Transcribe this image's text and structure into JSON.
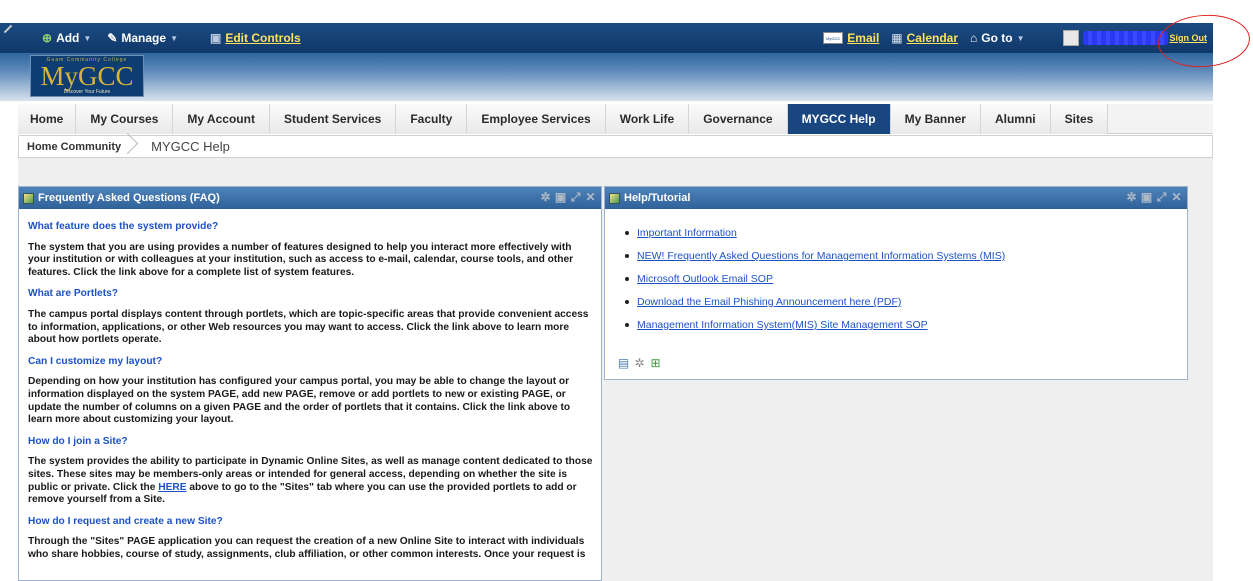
{
  "topbar": {
    "add_label": "Add",
    "manage_label": "Manage",
    "edit_controls_label": "Edit Controls",
    "email_label": "Email",
    "calendar_label": "Calendar",
    "goto_label": "Go to",
    "signout_label": "Sign Out"
  },
  "logo": {
    "top_text": "Guam Community College",
    "name": "MyGCC",
    "tagline": "Discover Your Future",
    "mini_logo_text": "MyGCC"
  },
  "nav": {
    "tabs": [
      {
        "label": "Home"
      },
      {
        "label": "My Courses"
      },
      {
        "label": "My Account"
      },
      {
        "label": "Student Services"
      },
      {
        "label": "Faculty"
      },
      {
        "label": "Employee Services"
      },
      {
        "label": "Work Life"
      },
      {
        "label": "Governance"
      },
      {
        "label": "MYGCC Help"
      },
      {
        "label": "My Banner"
      },
      {
        "label": "Alumni"
      },
      {
        "label": "Sites"
      }
    ],
    "active_tab": "MYGCC Help"
  },
  "breadcrumb": {
    "home": "Home Community",
    "current": "MYGCC Help"
  },
  "faq": {
    "title": "Frequently Asked Questions (FAQ)",
    "items": [
      {
        "q": "What feature does the system provide?",
        "a": "The system that you are using provides a number of features designed to help you interact more effectively with your institution or with colleagues at your institution, such as access to e-mail, calendar, course tools, and other features. Click the link above for a complete list of system features."
      },
      {
        "q": "What are Portlets?",
        "a": "The campus portal displays content through portlets, which are topic-specific areas that provide convenient access to information, applications, or other Web resources you may want to access. Click the link above to learn more about how portlets operate."
      },
      {
        "q": "Can I customize my layout?",
        "a": "Depending on how your institution has configured your campus portal, you may be able to change the layout or information displayed on the system PAGE, add new PAGE, remove or add portlets to new or existing PAGE, or update the number of columns on a given PAGE and the order of portlets that it contains. Click the link above to learn more about customizing your layout."
      },
      {
        "q": "How do I join a Site?",
        "a_before": "The system provides the ability to participate in Dynamic Online Sites, as well as manage content dedicated to those sites. These sites may be members-only areas or intended for general access, depending on whether the site is public or private. Click the ",
        "a_link": "HERE",
        "a_after": " above to go to the \"Sites\" tab where you can use the provided portlets to add or remove yourself from a Site."
      },
      {
        "q": "How do I request and create a new Site?",
        "a": "Through the \"Sites\" PAGE application you can request the creation of a new Online Site to interact with individuals who share hobbies, course of study, assignments, club affiliation, or other common interests. Once your request is"
      }
    ]
  },
  "help": {
    "title": "Help/Tutorial",
    "links": [
      "Important Information",
      "NEW! Frequently Asked Questions for Management Information Systems (MIS)",
      "Microsoft Outlook Email SOP",
      "Download the Email Phishing Announcement here (PDF)",
      "Management Information System(MIS) Site Management SOP"
    ]
  },
  "colors": {
    "header_dark": "#10386a",
    "accent_yellow": "#ffe25a",
    "active_tab": "#1a4680",
    "link_blue": "#1d52c7",
    "portlet_header": "#3a6da6",
    "annotation_red": "#e02020"
  }
}
